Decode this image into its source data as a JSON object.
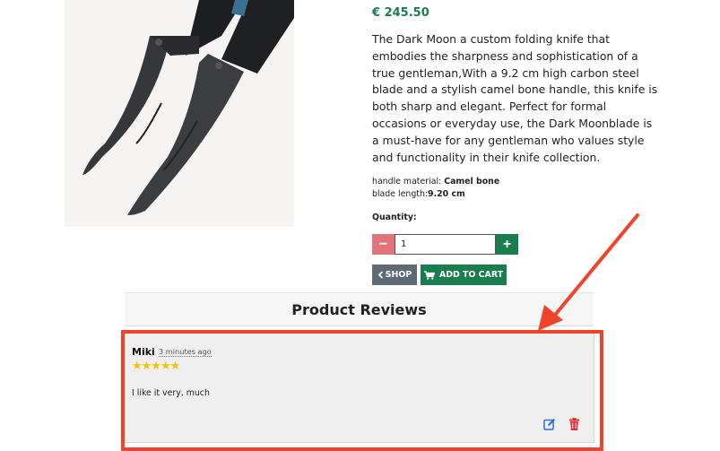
{
  "product": {
    "image_alt": "Dark Moon folding knives",
    "price": "€ 245.50",
    "description": "The Dark Moon a custom folding knife that embodies the sharpness and sophistication of a true gentleman,With a 9.2 cm high carbon steel blade and a stylish camel bone handle, this knife is both sharp and elegant. Perfect for formal occasions or everyday use, the Dark Moonblade is a must-have for any gentleman who values style and functionality in their knife collection.",
    "specs": [
      {
        "label": "handle material: ",
        "value": "Camel bone"
      },
      {
        "label": "blade length:",
        "value": "9.20 cm"
      }
    ],
    "quantity_label": "Quantity:",
    "quantity_value": "1",
    "minus_label": "−",
    "plus_label": "+",
    "shop_label": "SHOP",
    "add_to_cart_label": "ADD TO CART"
  },
  "reviews": {
    "title": "Product Reviews",
    "items": [
      {
        "author": "Miki",
        "time": "3 minutes ago",
        "stars": "★★★★★",
        "rating": 5,
        "text": "I like it very, much"
      }
    ]
  },
  "colors": {
    "accent_green": "#1a7d4e",
    "minus_red": "#e0737b",
    "shop_gray": "#606a74",
    "highlight": "#f0432a",
    "edit_blue": "#2f6fe0",
    "delete_red": "#e0303c"
  },
  "icons": {
    "shop": "chevron-left-icon",
    "cart": "cart-icon",
    "edit": "edit-icon",
    "delete": "trash-icon"
  }
}
